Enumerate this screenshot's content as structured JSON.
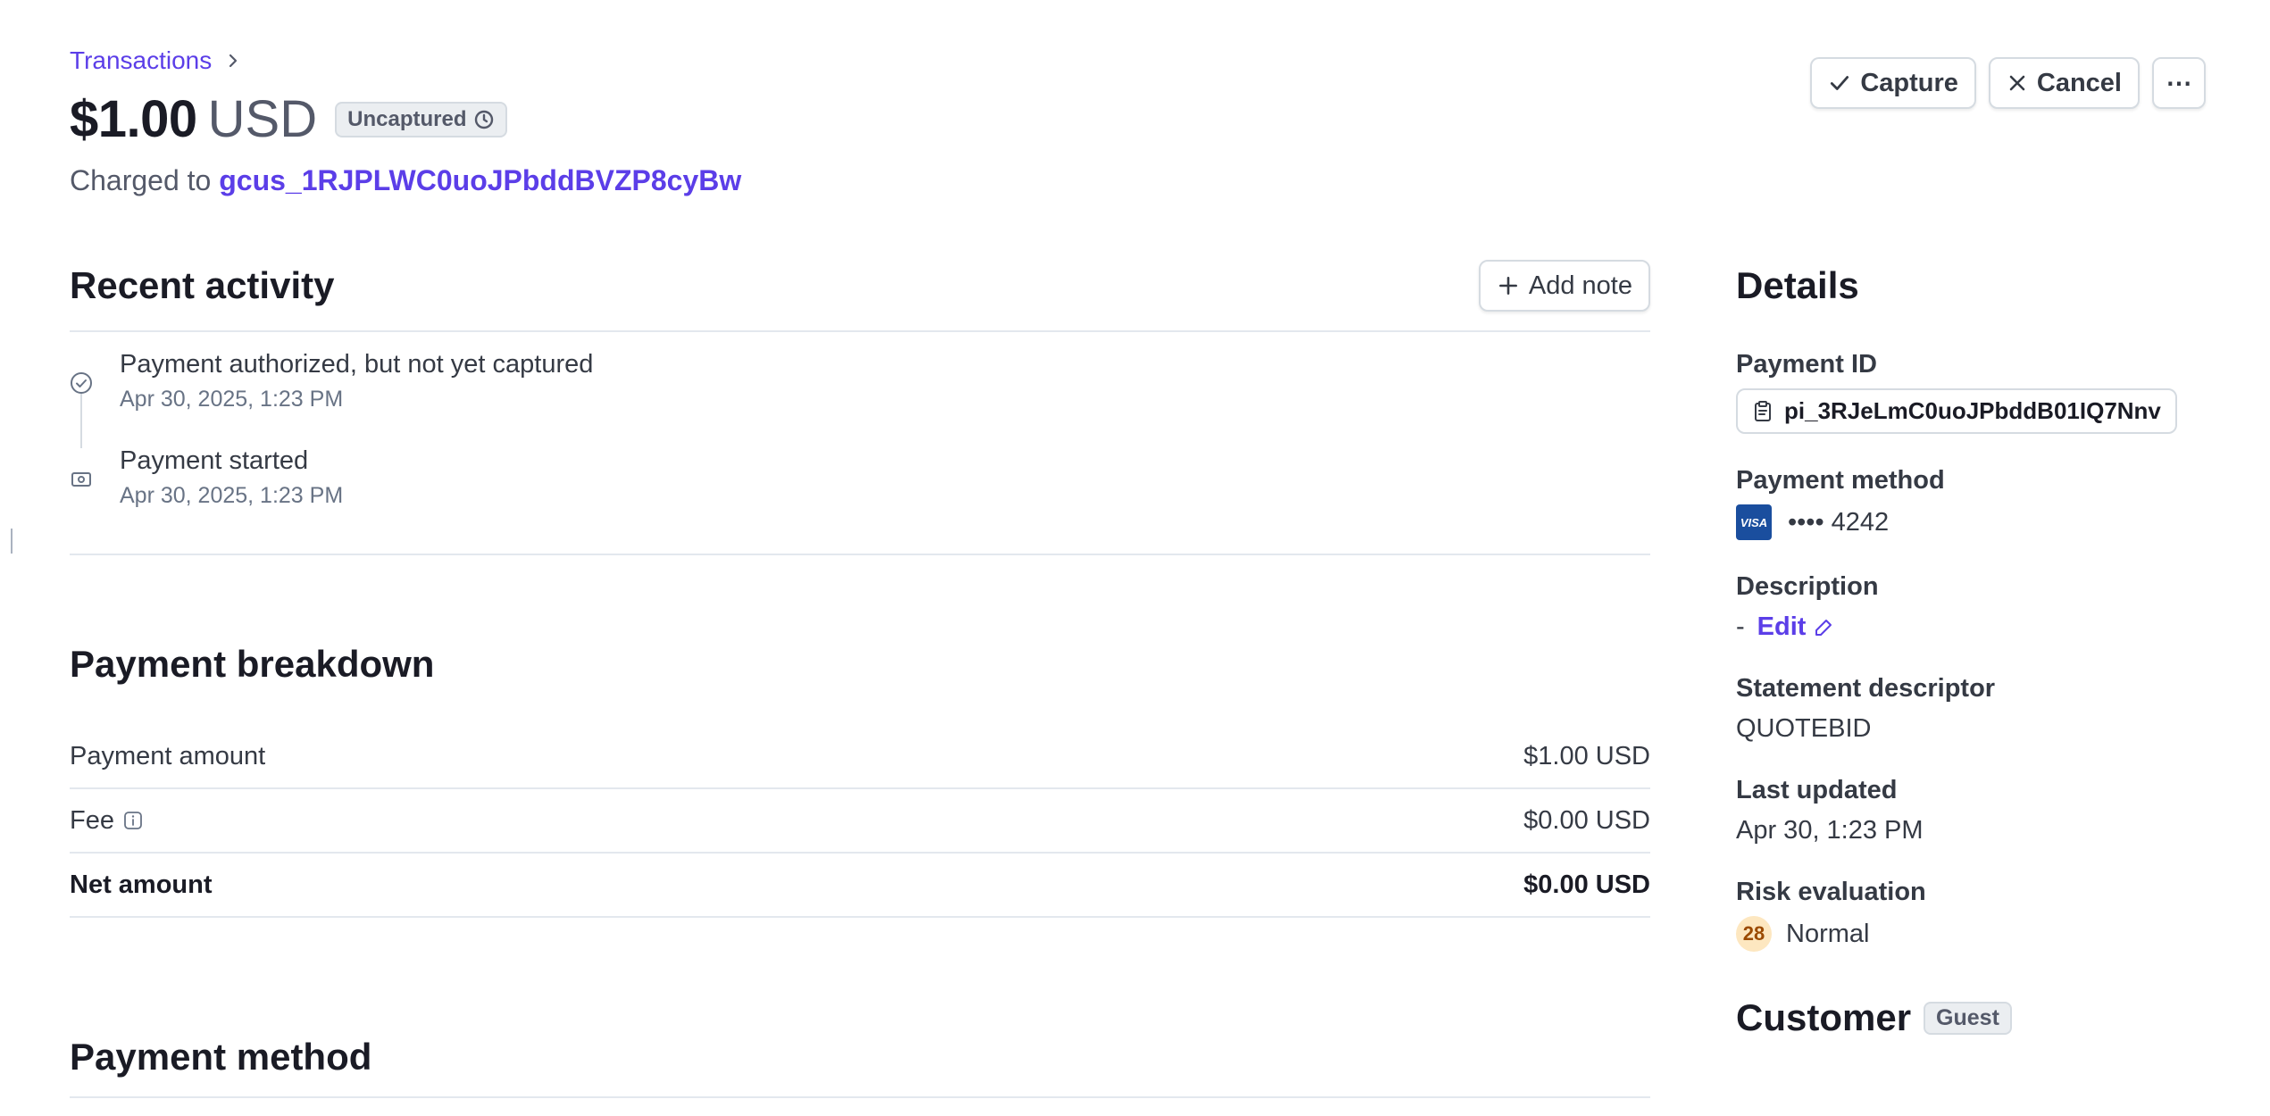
{
  "breadcrumb": {
    "label": "Transactions"
  },
  "header": {
    "amount": "$1.00",
    "currency": "USD",
    "status_badge": "Uncaptured",
    "charged_to_prefix": "Charged to",
    "customer_id": "gcus_1RJPLWC0uoJPbddBVZP8cyBw"
  },
  "actions": {
    "capture": "Capture",
    "cancel": "Cancel",
    "more": "⋯"
  },
  "recent_activity": {
    "title": "Recent activity",
    "add_note": "Add note",
    "items": [
      {
        "title": "Payment authorized, but not yet captured",
        "date": "Apr 30, 2025, 1:23 PM",
        "icon": "check-circle-icon"
      },
      {
        "title": "Payment started",
        "date": "Apr 30, 2025, 1:23 PM",
        "icon": "payment-icon"
      }
    ]
  },
  "breakdown": {
    "title": "Payment breakdown",
    "rows": [
      {
        "label": "Payment amount",
        "value": "$1.00 USD"
      },
      {
        "label": "Fee",
        "value": "$0.00 USD"
      },
      {
        "label": "Net amount",
        "value": "$0.00 USD"
      }
    ]
  },
  "payment_method_section": {
    "title": "Payment method"
  },
  "details": {
    "title": "Details",
    "payment_id_label": "Payment ID",
    "payment_id": "pi_3RJeLmC0uoJPbddB01IQ7Nnv",
    "payment_method_label": "Payment method",
    "card_brand": "VISA",
    "card_masked": "•••• 4242",
    "description_label": "Description",
    "description_value": "-",
    "description_edit": "Edit",
    "statement_label": "Statement descriptor",
    "statement_value": "QUOTEBID",
    "last_updated_label": "Last updated",
    "last_updated_value": "Apr 30, 1:23 PM",
    "risk_label": "Risk evaluation",
    "risk_score": "28",
    "risk_value": "Normal"
  },
  "customer": {
    "title": "Customer",
    "badge": "Guest"
  },
  "colors": {
    "accent": "#5b3ee8",
    "risk_bg": "#fde7c0",
    "visa": "#1a4e9e"
  }
}
